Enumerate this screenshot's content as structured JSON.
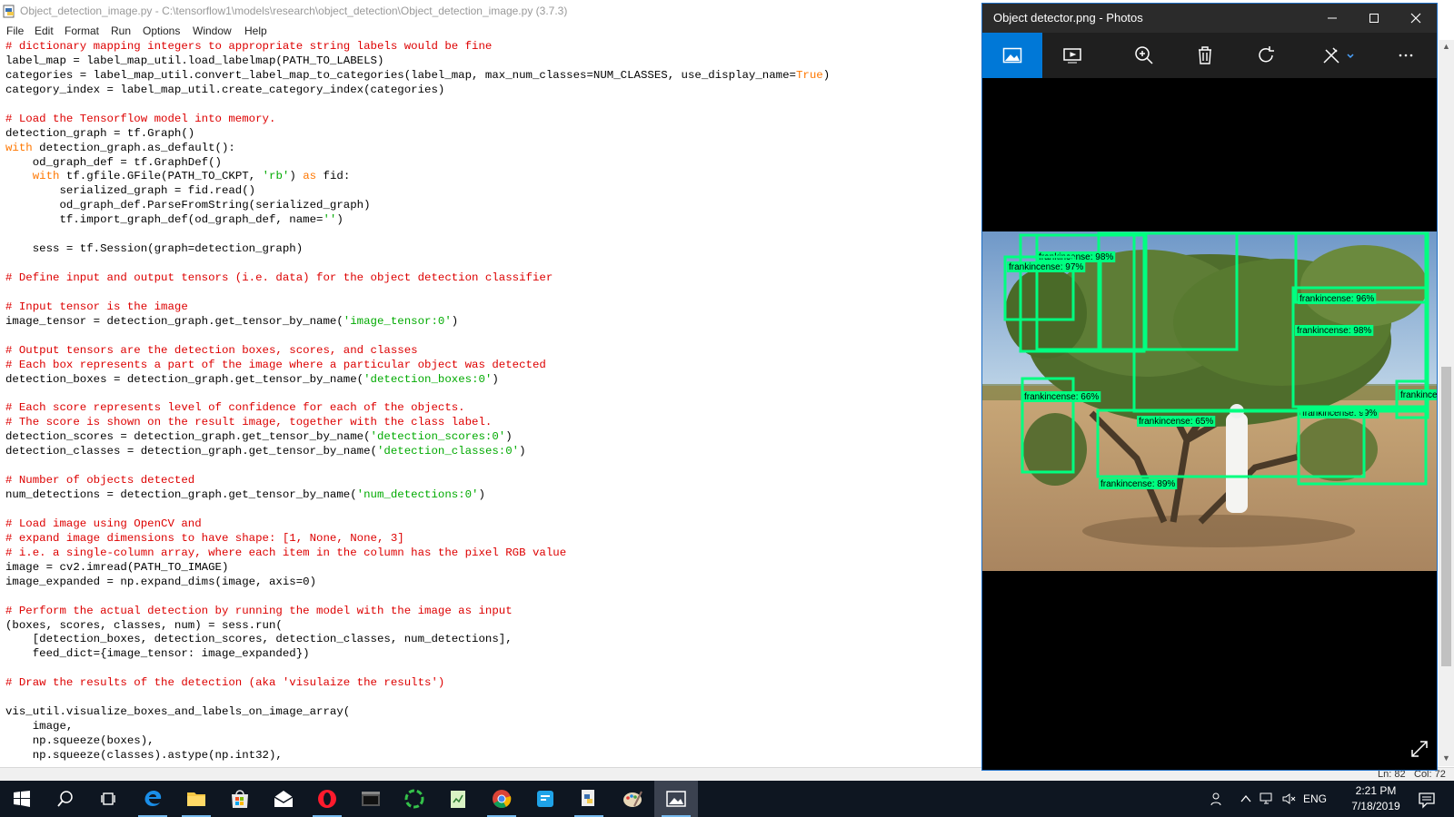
{
  "idle": {
    "title": "Object_detection_image.py - C:\\tensorflow1\\models\\research\\object_detection\\Object_detection_image.py (3.7.3)",
    "menu": [
      "File",
      "Edit",
      "Format",
      "Run",
      "Options",
      "Window",
      "Help"
    ],
    "status": {
      "line": "Ln: 82",
      "col": "Col: 72"
    },
    "code_lines": [
      [
        [
          "cm",
          "# dictionary mapping integers to appropriate string labels would be fine"
        ]
      ],
      [
        [
          "",
          "label_map = label_map_util.load_labelmap(PATH_TO_LABELS)"
        ]
      ],
      [
        [
          "",
          "categories = label_map_util.convert_label_map_to_categories(label_map, max_num_classes=NUM_CLASSES, use_display_name="
        ],
        [
          "kw",
          "True"
        ],
        [
          "",
          ")"
        ]
      ],
      [
        [
          "",
          "category_index = label_map_util.create_category_index(categories)"
        ]
      ],
      [
        [
          "",
          ""
        ]
      ],
      [
        [
          "cm",
          "# Load the Tensorflow model into memory."
        ]
      ],
      [
        [
          "",
          "detection_graph = tf.Graph()"
        ]
      ],
      [
        [
          "kw",
          "with"
        ],
        [
          "",
          " detection_graph.as_default():"
        ]
      ],
      [
        [
          "",
          "    od_graph_def = tf.GraphDef()"
        ]
      ],
      [
        [
          "",
          "    "
        ],
        [
          "kw",
          "with"
        ],
        [
          "",
          " tf.gfile.GFile(PATH_TO_CKPT, "
        ],
        [
          "st",
          "'rb'"
        ],
        [
          "",
          ") "
        ],
        [
          "kw",
          "as"
        ],
        [
          "",
          " fid:"
        ]
      ],
      [
        [
          "",
          "        serialized_graph = fid.read()"
        ]
      ],
      [
        [
          "",
          "        od_graph_def.ParseFromString(serialized_graph)"
        ]
      ],
      [
        [
          "",
          "        tf.import_graph_def(od_graph_def, name="
        ],
        [
          "st",
          "''"
        ],
        [
          "",
          ")"
        ]
      ],
      [
        [
          "",
          ""
        ]
      ],
      [
        [
          "",
          "    sess = tf.Session(graph=detection_graph)"
        ]
      ],
      [
        [
          "",
          ""
        ]
      ],
      [
        [
          "cm",
          "# Define input and output tensors (i.e. data) for the object detection classifier"
        ]
      ],
      [
        [
          "",
          ""
        ]
      ],
      [
        [
          "cm",
          "# Input tensor is the image"
        ]
      ],
      [
        [
          "",
          "image_tensor = detection_graph.get_tensor_by_name("
        ],
        [
          "st",
          "'image_tensor:0'"
        ],
        [
          "",
          ")"
        ]
      ],
      [
        [
          "",
          ""
        ]
      ],
      [
        [
          "cm",
          "# Output tensors are the detection boxes, scores, and classes"
        ]
      ],
      [
        [
          "cm",
          "# Each box represents a part of the image where a particular object was detected"
        ]
      ],
      [
        [
          "",
          "detection_boxes = detection_graph.get_tensor_by_name("
        ],
        [
          "st",
          "'detection_boxes:0'"
        ],
        [
          "",
          ")"
        ]
      ],
      [
        [
          "",
          ""
        ]
      ],
      [
        [
          "cm",
          "# Each score represents level of confidence for each of the objects."
        ]
      ],
      [
        [
          "cm",
          "# The score is shown on the result image, together with the class label."
        ]
      ],
      [
        [
          "",
          "detection_scores = detection_graph.get_tensor_by_name("
        ],
        [
          "st",
          "'detection_scores:0'"
        ],
        [
          "",
          ")"
        ]
      ],
      [
        [
          "",
          "detection_classes = detection_graph.get_tensor_by_name("
        ],
        [
          "st",
          "'detection_classes:0'"
        ],
        [
          "",
          ")"
        ]
      ],
      [
        [
          "",
          ""
        ]
      ],
      [
        [
          "cm",
          "# Number of objects detected"
        ]
      ],
      [
        [
          "",
          "num_detections = detection_graph.get_tensor_by_name("
        ],
        [
          "st",
          "'num_detections:0'"
        ],
        [
          "",
          ")"
        ]
      ],
      [
        [
          "",
          ""
        ]
      ],
      [
        [
          "cm",
          "# Load image using OpenCV and"
        ]
      ],
      [
        [
          "cm",
          "# expand image dimensions to have shape: [1, None, None, 3]"
        ]
      ],
      [
        [
          "cm",
          "# i.e. a single-column array, where each item in the column has the pixel RGB value"
        ]
      ],
      [
        [
          "",
          "image = cv2.imread(PATH_TO_IMAGE)"
        ]
      ],
      [
        [
          "",
          "image_expanded = np.expand_dims(image, axis=0)"
        ]
      ],
      [
        [
          "",
          ""
        ]
      ],
      [
        [
          "cm",
          "# Perform the actual detection by running the model with the image as input"
        ]
      ],
      [
        [
          "",
          "(boxes, scores, classes, num) = sess.run("
        ]
      ],
      [
        [
          "",
          "    [detection_boxes, detection_scores, detection_classes, num_detections],"
        ]
      ],
      [
        [
          "",
          "    feed_dict={image_tensor: image_expanded})"
        ]
      ],
      [
        [
          "",
          ""
        ]
      ],
      [
        [
          "cm",
          "# Draw the results of the detection (aka 'visulaize the results')"
        ]
      ],
      [
        [
          "",
          ""
        ]
      ],
      [
        [
          "",
          "vis_util.visualize_boxes_and_labels_on_image_array("
        ]
      ],
      [
        [
          "",
          "    image,"
        ]
      ],
      [
        [
          "",
          "    np.squeeze(boxes),"
        ]
      ],
      [
        [
          "",
          "    np.squeeze(classes).astype(np.int32),"
        ]
      ]
    ]
  },
  "photos": {
    "title": "Object detector.png - Photos",
    "toolbar_icons": [
      "view-image-icon",
      "slideshow-icon",
      "zoom-icon",
      "delete-icon",
      "rotate-icon",
      "edit-icon",
      "more-icon"
    ],
    "detections": [
      {
        "label": "frankincense: 98%"
      },
      {
        "label": "frankincense: 97%"
      },
      {
        "label": "frankincense: 96%"
      },
      {
        "label": "frankincense: 98%"
      },
      {
        "label": "frankincense: 66%"
      },
      {
        "label": "frankincense: 65%"
      },
      {
        "label": "frankincense: 99%"
      },
      {
        "label": "frankincense: 89%"
      },
      {
        "label": "frankincense"
      }
    ]
  },
  "taskbar": {
    "apps": [
      "start-icon",
      "search-icon",
      "task-view-icon",
      "edge-icon",
      "file-explorer-icon",
      "store-icon",
      "mail-icon",
      "opera-icon",
      "terminal-icon",
      "app-circle-icon",
      "notepad-icon",
      "chrome-icon",
      "app-blue-icon",
      "python-icon",
      "paint-icon",
      "photos-icon"
    ],
    "lang": "ENG",
    "time": "2:21 PM",
    "date": "7/18/2019",
    "box_color": "#00ff80"
  }
}
